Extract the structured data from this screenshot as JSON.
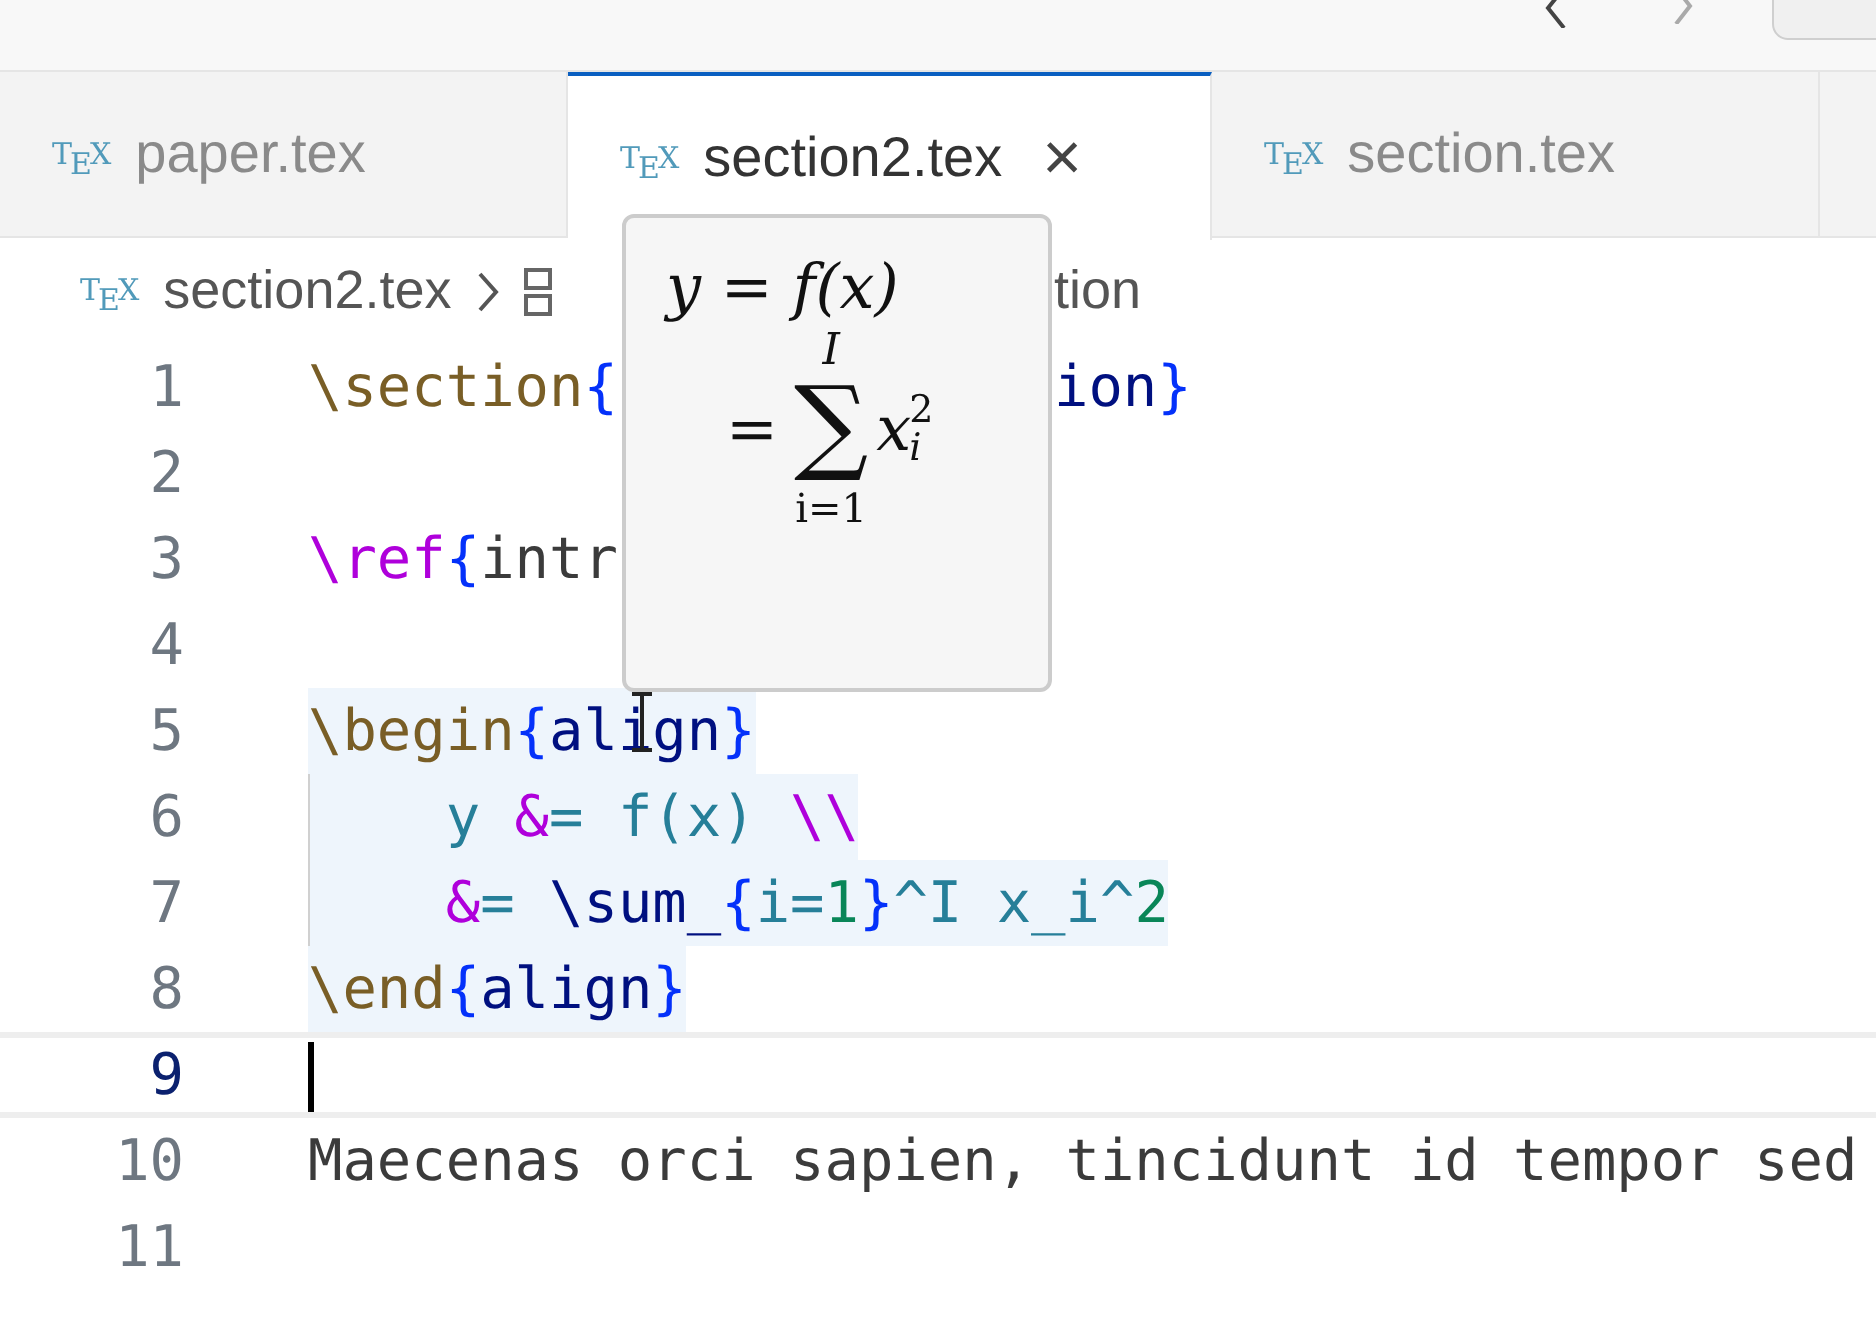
{
  "tabs": [
    {
      "logo": "TEX",
      "label": "paper.tex",
      "selected": false
    },
    {
      "logo": "TEX",
      "label": "section2.tex",
      "selected": true,
      "close": "×"
    },
    {
      "logo": "TEX",
      "label": "section.tex",
      "selected": false
    }
  ],
  "breadcrumb": {
    "logo": "TEX",
    "file": "section2.tex",
    "symbol": "tion"
  },
  "lines": [
    {
      "number": "1",
      "current": false,
      "selected": false,
      "guide": false,
      "tokens": [
        {
          "text": "\\section",
          "kind": "command"
        },
        {
          "text": "{",
          "kind": "brace"
        }
      ],
      "after_popup": [
        {
          "text": "ion",
          "kind": "arg"
        },
        {
          "text": "}",
          "kind": "brace"
        }
      ]
    },
    {
      "number": "2",
      "current": false
    },
    {
      "number": "3",
      "current": false,
      "selected": false,
      "guide": false,
      "tokens": [
        {
          "text": "\\ref",
          "kind": "ref"
        },
        {
          "text": "{",
          "kind": "brace"
        },
        {
          "text": "intr",
          "kind": "plain"
        }
      ]
    },
    {
      "number": "4",
      "current": false
    },
    {
      "number": "5",
      "current": false,
      "selected": true,
      "guide": false,
      "tokens": [
        {
          "text": "\\begin",
          "kind": "command"
        },
        {
          "text": "{",
          "kind": "brace"
        },
        {
          "text": "align",
          "kind": "arg"
        },
        {
          "text": "}",
          "kind": "brace"
        }
      ]
    },
    {
      "number": "6",
      "current": false,
      "selected": true,
      "guide": true,
      "tokens": [
        {
          "text": "    y ",
          "kind": "math"
        },
        {
          "text": "&",
          "kind": "ref"
        },
        {
          "text": "= f(x) ",
          "kind": "math"
        },
        {
          "text": "\\\\",
          "kind": "ref"
        }
      ]
    },
    {
      "number": "7",
      "current": false,
      "selected": true,
      "guide": true,
      "tokens": [
        {
          "text": "    &",
          "kind": "ref"
        },
        {
          "text": "= ",
          "kind": "math"
        },
        {
          "text": "\\sum_",
          "kind": "arg"
        },
        {
          "text": "{",
          "kind": "brace"
        },
        {
          "text": "i=",
          "kind": "math"
        },
        {
          "text": "1",
          "kind": "num"
        },
        {
          "text": "}",
          "kind": "brace"
        },
        {
          "text": "^I x_i^",
          "kind": "math"
        },
        {
          "text": "2",
          "kind": "num"
        }
      ]
    },
    {
      "number": "8",
      "current": false,
      "selected": true,
      "guide": false,
      "tokens": [
        {
          "text": "\\end",
          "kind": "command"
        },
        {
          "text": "{",
          "kind": "brace"
        },
        {
          "text": "align",
          "kind": "arg"
        },
        {
          "text": "}",
          "kind": "brace"
        }
      ]
    },
    {
      "number": "9",
      "current": true
    },
    {
      "number": "10",
      "current": false,
      "selected": false,
      "guide": false,
      "tokens": [
        {
          "text": "Maecenas orci sapien, tincidunt id tempor sed",
          "kind": "plain"
        }
      ]
    },
    {
      "number": "11",
      "current": false
    }
  ],
  "preview": {
    "line1": {
      "lhs": "y",
      "rel": "=",
      "rhs": "f(x)"
    },
    "line2": {
      "rel": "=",
      "op": "∑",
      "upper": "I",
      "lower": "i=1",
      "term": "x",
      "sub": "i",
      "sup": "2"
    }
  }
}
